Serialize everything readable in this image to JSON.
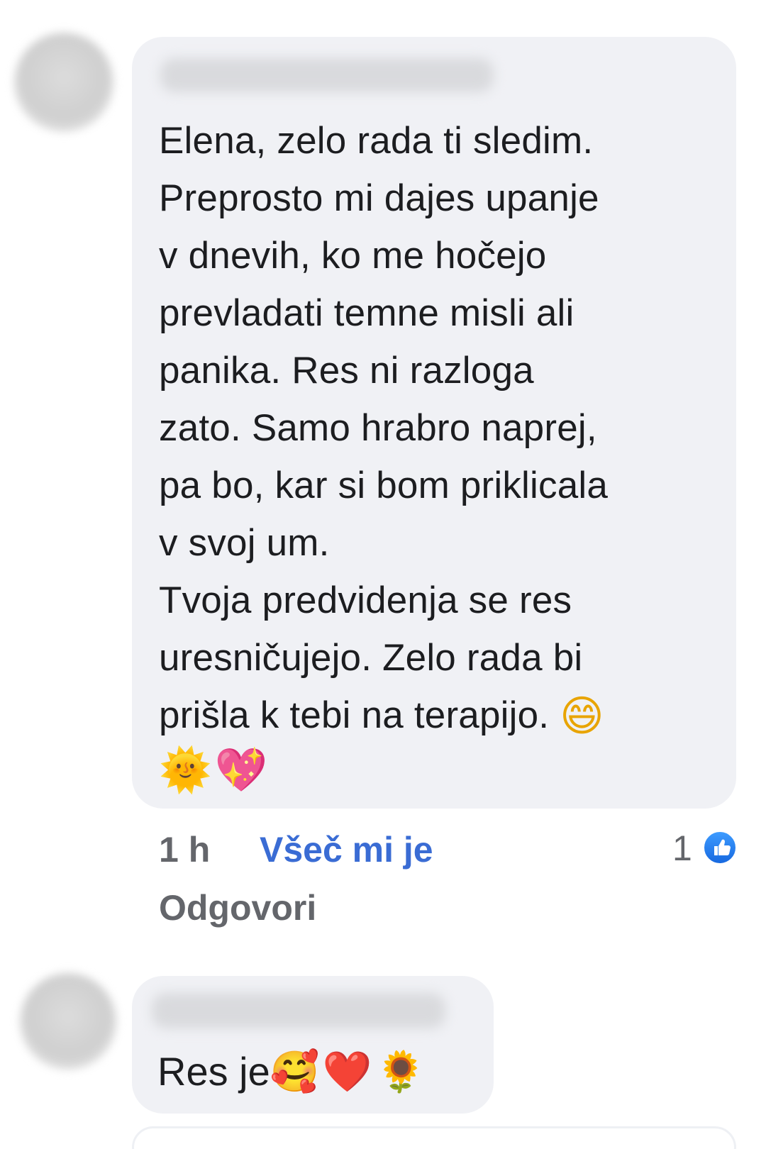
{
  "comments": [
    {
      "author_name": "",
      "text": "Elena, zelo rada ti sledim.\nPreprosto mi dajes upanje\nv dnevih, ko me hočejo\nprevladati temne misli ali\npanika. Res ni razloga\nzato. Samo hrabro naprej,\npa bo, kar si bom priklicala\nv svoj um.\nTvoja predvidenja se res\nuresničujejo. Zelo rada bi\nprišla k tebi na terapijo.",
      "trailing_emoji": "😄",
      "emoji_line": [
        "🌞",
        "💖"
      ],
      "time": "1 h",
      "like_label": "Všeč mi je",
      "reply_label": "Odgovori",
      "reaction_count": "1",
      "reaction_icon": "like-thumb-icon"
    },
    {
      "author_name": "",
      "text": "Res je",
      "emojis": [
        "🥰",
        "❤️",
        "🌻"
      ]
    }
  ],
  "colors": {
    "bubble": "#f0f1f5",
    "like_link": "#3a6cd4",
    "meta": "#64666b",
    "like_badge": "#1769e0"
  }
}
